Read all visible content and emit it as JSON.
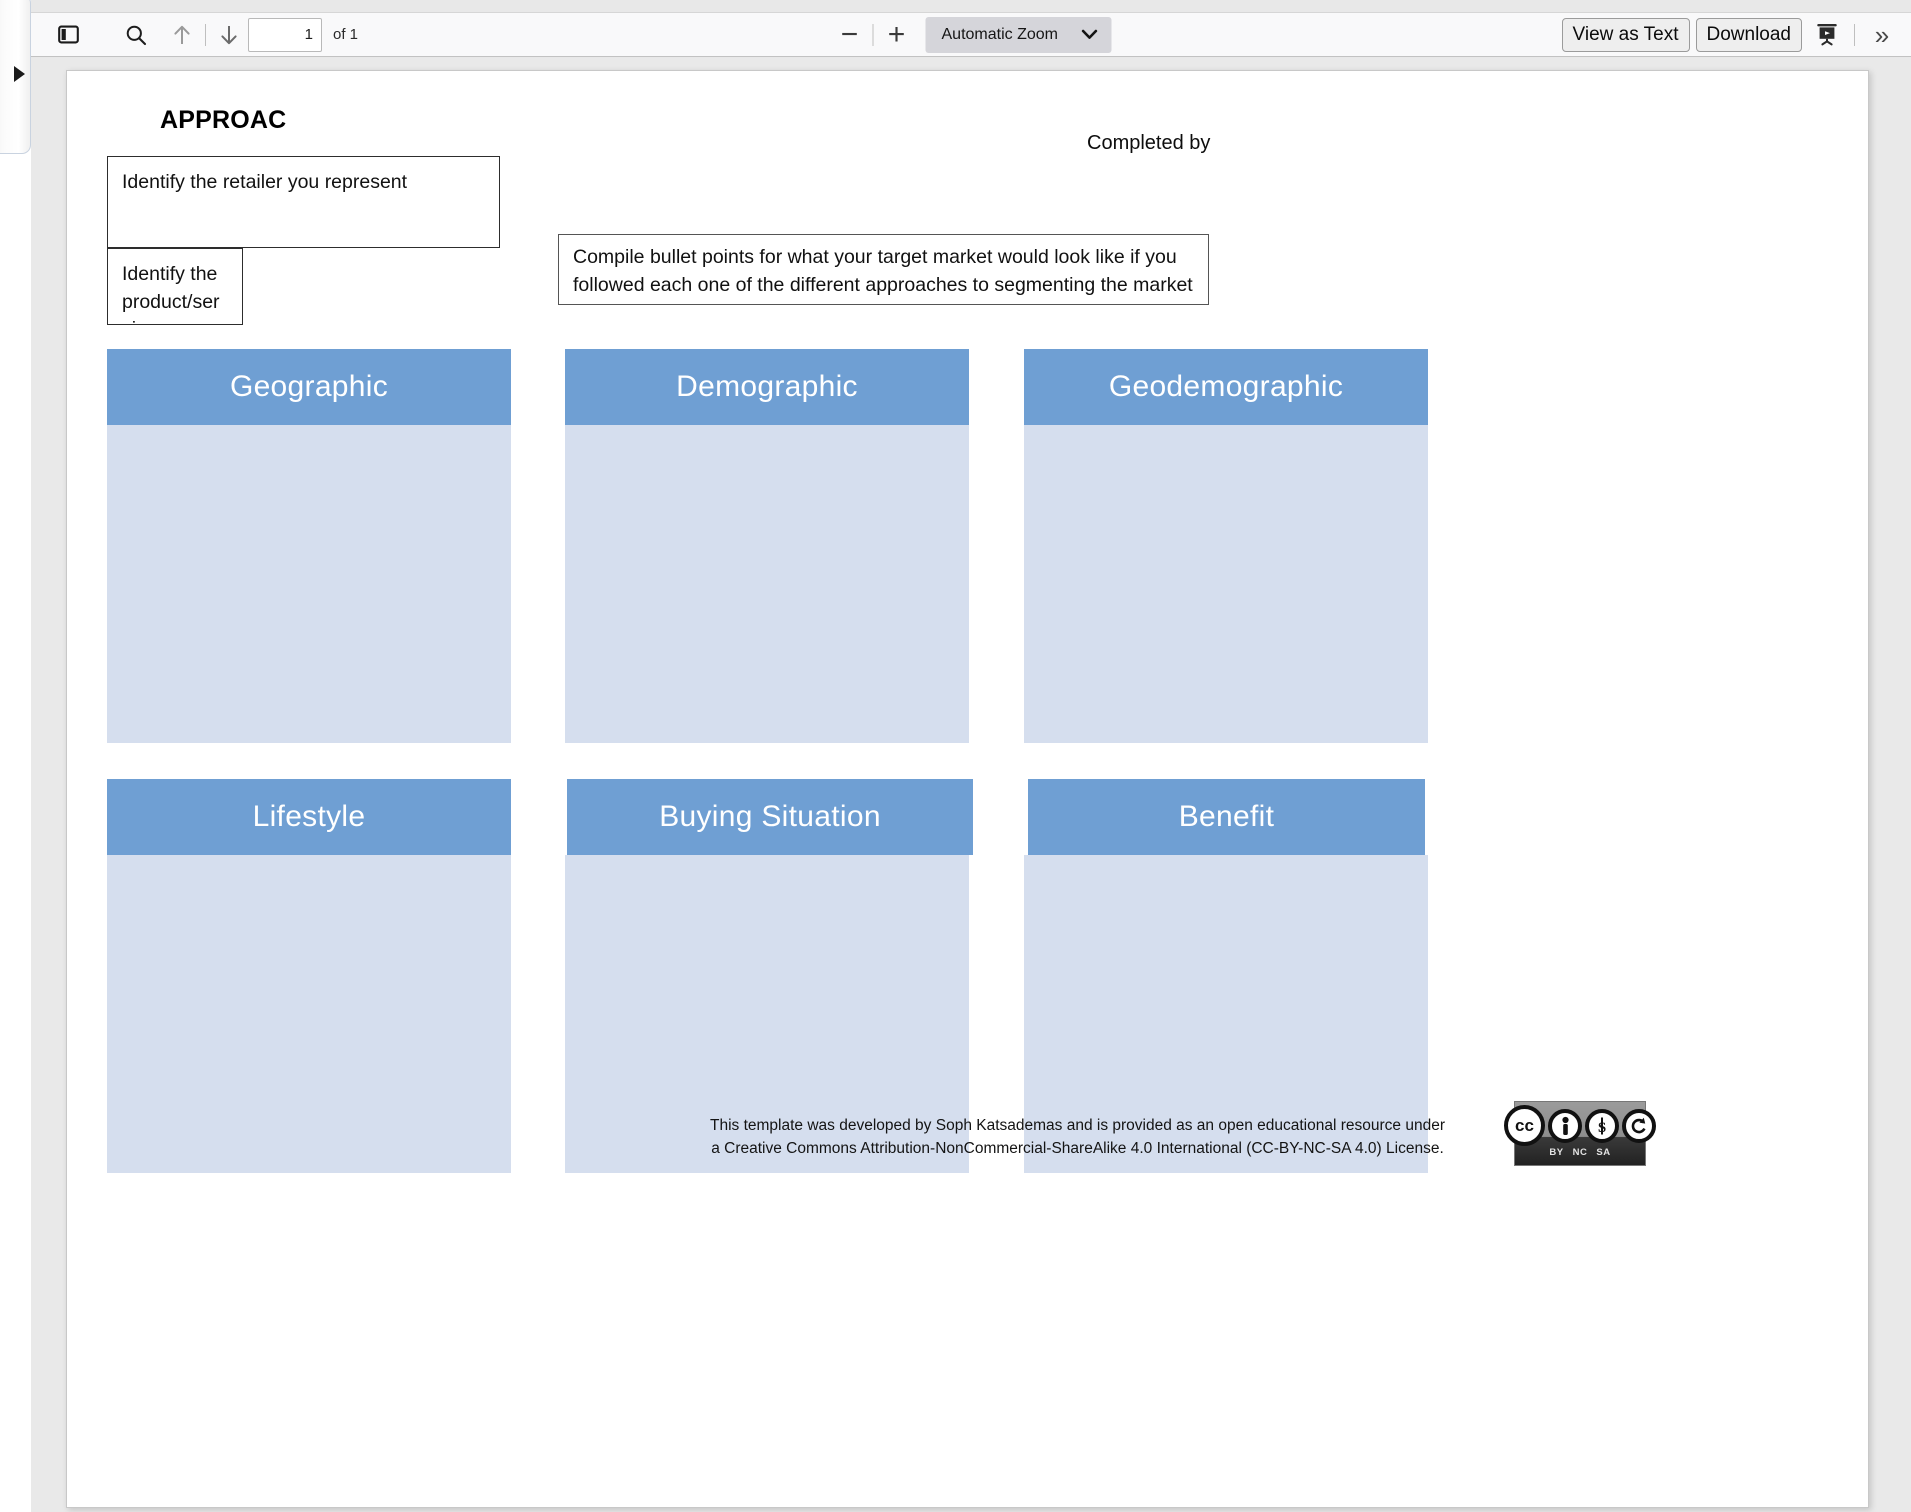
{
  "toolbar": {
    "sidebar_toggle_icon": "sidebar-toggle-icon",
    "find_icon": "search-icon",
    "prev_page_icon": "arrow-up-icon",
    "next_page_icon": "arrow-down-icon",
    "page_number_value": "1",
    "page_count_label": "of 1",
    "zoom_out_glyph": "−",
    "zoom_in_glyph": "+",
    "zoom_level_label": "Automatic Zoom",
    "zoom_chevron_icon": "chevron-down-icon",
    "view_as_text_label": "View as Text",
    "download_label": "Download",
    "presentation_icon": "presentation-mode-icon",
    "more_tools_glyph": "»"
  },
  "sidebar": {
    "expander_icon": "triangle-right-icon"
  },
  "document": {
    "title": "APPROAC",
    "completed_by": "Completed by",
    "boxes": [
      {
        "id": "retailer",
        "text": "Identify the retailer you represent"
      },
      {
        "id": "product",
        "text": "Identify the product/ser vice you are"
      },
      {
        "id": "compile",
        "text": "Compile bullet points for what your target market would look like if you followed each one of the different approaches to segmenting the market"
      }
    ],
    "segments": [
      {
        "id": "geographic",
        "label": "Geographic"
      },
      {
        "id": "demographic",
        "label": "Demographic"
      },
      {
        "id": "geodemographic",
        "label": "Geodemographic"
      },
      {
        "id": "lifestyle",
        "label": "Lifestyle"
      },
      {
        "id": "buying",
        "label": "Buying Situation"
      },
      {
        "id": "benefit",
        "label": "Benefit"
      }
    ],
    "footer": {
      "line1": "This template was developed by Soph Katsademas and is provided as an open educational resource under",
      "line2": "a Creative Commons Attribution-NonCommercial-ShareAlike 4.0 International (CC-BY-NC-SA 4.0) License.",
      "cc_badge": {
        "mark": "cc",
        "labels": [
          "BY",
          "NC",
          "SA"
        ]
      }
    }
  },
  "colors": {
    "segment_header": "#6F9FD3",
    "segment_body": "#D5DEEE",
    "toolbar_bg": "#F9F9FA",
    "zoom_select_bg": "#D5D5DA",
    "viewer_bg": "#E9E9E9"
  }
}
